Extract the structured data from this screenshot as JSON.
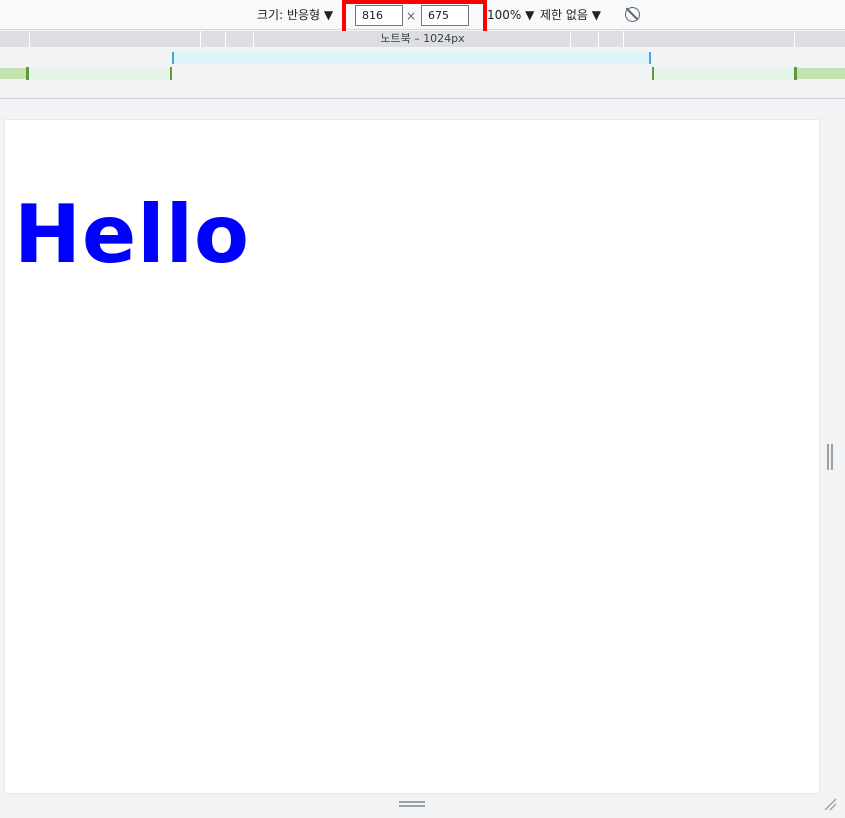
{
  "toolbar": {
    "size_mode_label": "크기: 반응형 ▼",
    "width_value": "816",
    "times_sign": "×",
    "height_value": "675",
    "zoom_label": "100% ▼",
    "throttle_label": "제한 없음 ▼",
    "rotate_icon": "rotate-icon"
  },
  "media_query_bar": {
    "label": "노트북 – 1024px"
  },
  "page": {
    "heading": "Hello",
    "heading_color": "#0000ff"
  },
  "colors": {
    "highlight": "#ff0000",
    "range_blue": "#4aa3e0",
    "range_green": "#5d9b3a"
  },
  "icons": {
    "right_handle": "vertical-resize-handle-icon",
    "bottom_handle": "horizontal-resize-handle-icon",
    "corner_handle": "corner-resize-icon"
  }
}
